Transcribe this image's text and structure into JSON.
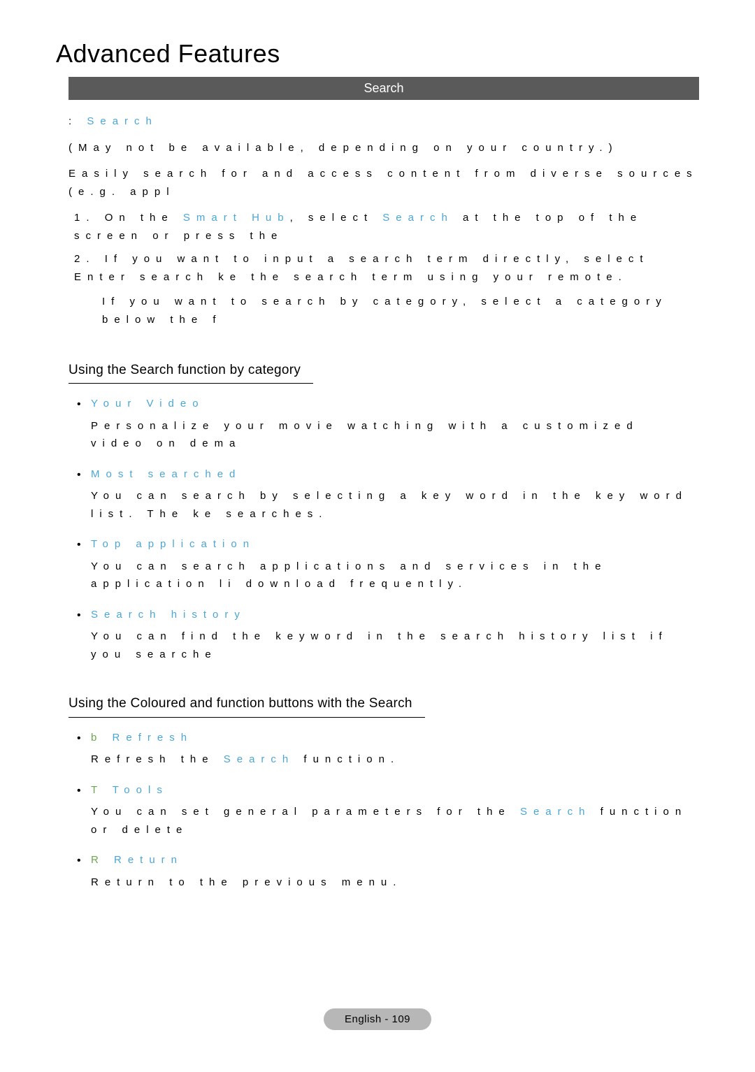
{
  "page_title": "Advanced Features",
  "section_bar": "Search",
  "intro": {
    "prefix": ":",
    "label": "Search",
    "availability": "(May not be available, depending on your country.)",
    "desc": "Easily search for and access content from diverse sources (e.g. appl"
  },
  "steps": [
    {
      "num": "1.",
      "before": "On the ",
      "hl1": "Smart Hub",
      "mid": ", select ",
      "hl2": "Search",
      "after": " at the top of the screen or press the "
    },
    {
      "num": "2.",
      "text": "If you want to input a search term directly, select Enter search ke the search term using your remote."
    }
  ],
  "step_sub": "If you want to search by category, select a category below the f",
  "sub1": {
    "heading": "Using the Search function by category",
    "items": [
      {
        "title": "Your Video",
        "body": "Personalize your movie watching with a customized video on dema"
      },
      {
        "title": "Most searched",
        "body": "You can search by selecting a key word in the key word list. The ke searches."
      },
      {
        "title": "Top application",
        "body": "You can search applications and services in the application li download frequently."
      },
      {
        "title": "Search history",
        "body": "You can find the keyword in the search history list if you searche"
      }
    ]
  },
  "sub2": {
    "heading": "Using the Coloured and function buttons with the Search",
    "items": [
      {
        "prefix": "b ",
        "title": "Refresh",
        "before": "Refresh the ",
        "hl": "Search",
        "after": " function."
      },
      {
        "prefix": "T ",
        "title": "Tools",
        "before": "You can set general parameters for the ",
        "hl": "Search",
        "after": " function or delete"
      },
      {
        "prefix": "R ",
        "title": "Return",
        "body": "Return to the previous menu."
      }
    ]
  },
  "footer": "English - 109"
}
